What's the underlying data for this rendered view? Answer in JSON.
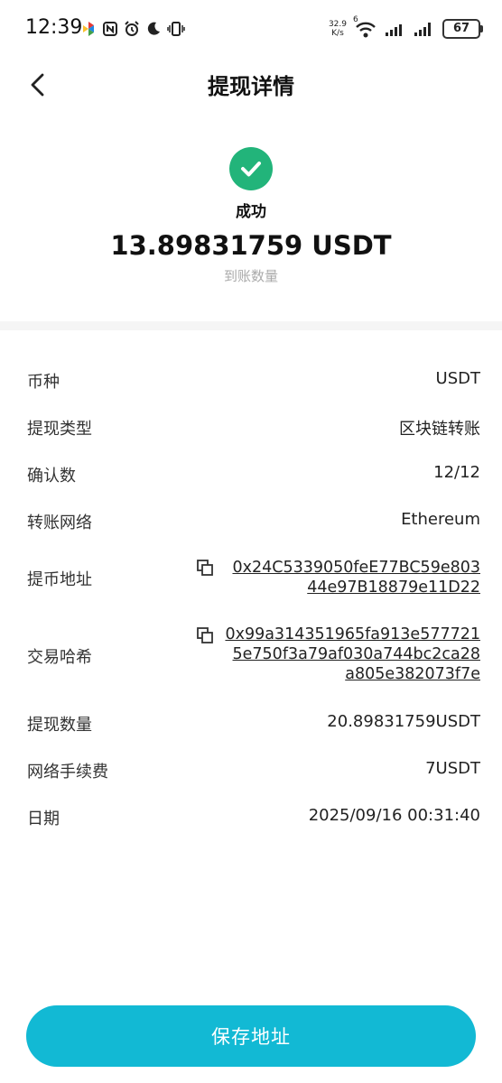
{
  "status_bar": {
    "time": "12:39",
    "net_speed_value": "32.9",
    "net_speed_unit": "K/s",
    "wifi_badge": "6",
    "battery": "67"
  },
  "header": {
    "title": "提现详情",
    "back_icon": "chevron-left-icon"
  },
  "status": {
    "icon": "check-circle-icon",
    "icon_color": "#22b47a",
    "text": "成功",
    "amount": "13.89831759 USDT",
    "amount_label": "到账数量"
  },
  "details": {
    "currency_label": "币种",
    "currency_value": "USDT",
    "type_label": "提现类型",
    "type_value": "区块链转账",
    "confirm_label": "确认数",
    "confirm_value": "12/12",
    "network_label": "转账网络",
    "network_value": "Ethereum",
    "address_label": "提币地址",
    "address_line1": "0x24C5339050feE77BC59e803",
    "address_line2": "44e97B18879e11D22",
    "hash_label": "交易哈希",
    "hash_line1": "0x99a314351965fa913e577721",
    "hash_line2": "5e750f3a79af030a744bc2ca28",
    "hash_line3": "a805e382073f7e",
    "withdraw_amount_label": "提现数量",
    "withdraw_amount_value": "20.89831759USDT",
    "fee_label": "网络手续费",
    "fee_value": "7USDT",
    "date_label": "日期",
    "date_value": "2025/09/16 00:31:40"
  },
  "save_button": {
    "label": "保存地址",
    "color": "#12b9d4"
  }
}
